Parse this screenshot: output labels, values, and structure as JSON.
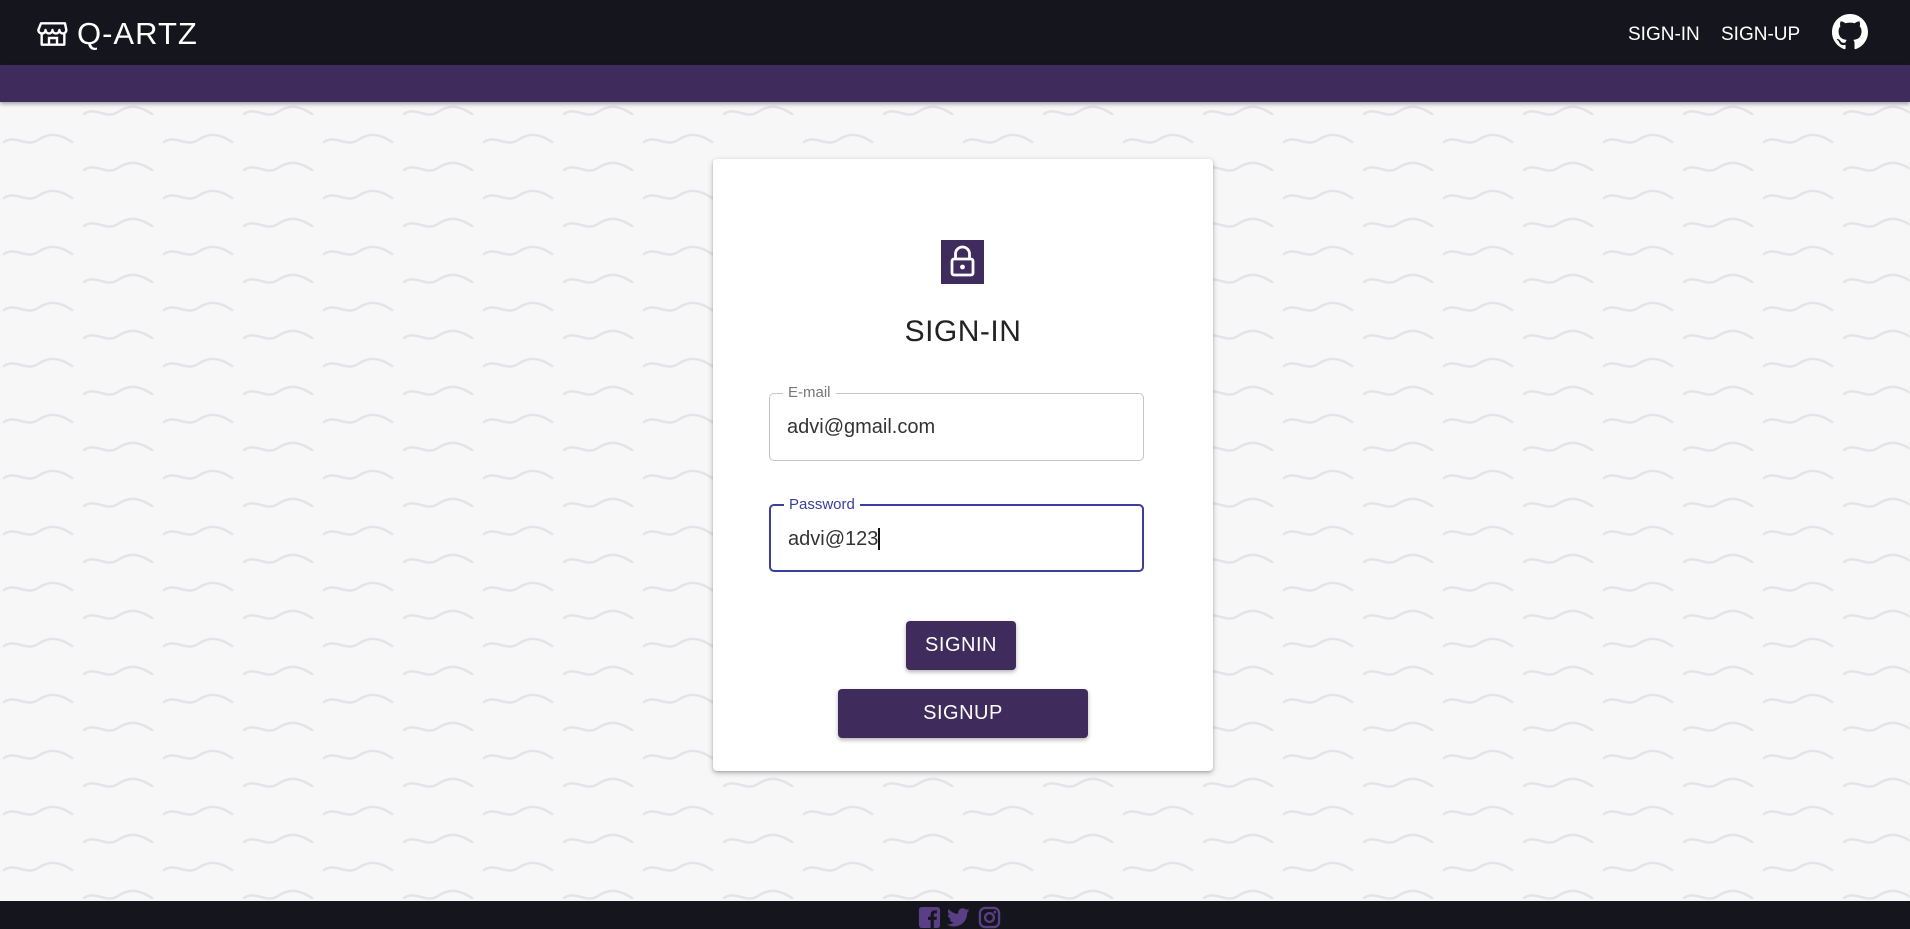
{
  "header": {
    "brand": "Q-ARTZ",
    "brand_icon": "store-icon",
    "nav": {
      "signin": "SIGN-IN",
      "signup": "SIGN-UP"
    },
    "github_icon": "github-icon"
  },
  "colors": {
    "topbar": "#15161d",
    "accent": "#402c5c",
    "focus": "#3a3f99"
  },
  "card": {
    "icon": "lock-icon",
    "title": "SIGN-IN",
    "email": {
      "label": "E-mail",
      "value": "advi@gmail.com"
    },
    "password": {
      "label": "Password",
      "value": "advi@123"
    },
    "signin_button": "SIGNIN",
    "signup_button": "SIGNUP"
  },
  "footer": {
    "icons": [
      "facebook-icon",
      "twitter-icon",
      "instagram-icon"
    ]
  }
}
